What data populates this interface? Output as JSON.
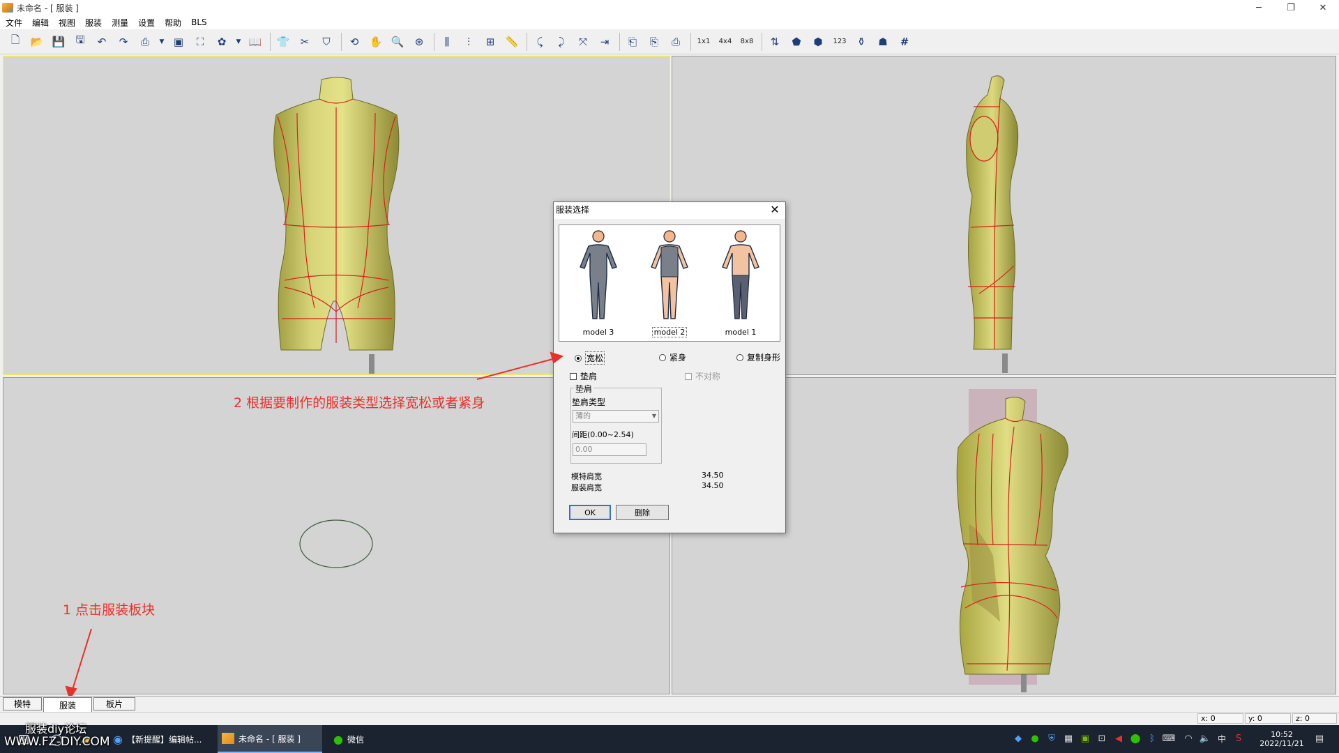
{
  "window": {
    "title": "未命名 - [ 服装 ]",
    "minimize_glyph": "─",
    "restore_glyph": "❐",
    "close_glyph": "✕"
  },
  "menu": [
    "文件",
    "编辑",
    "视图",
    "服装",
    "测量",
    "设置",
    "帮助",
    "BLS"
  ],
  "toolbar": {
    "icons": [
      "new-file-icon",
      "open-file-icon",
      "save-icon",
      "save-as-icon",
      "undo-icon",
      "redo-icon",
      "print-icon",
      "layout-icon",
      "view-image-icon",
      "texture-icon",
      "book-icon",
      "shirt-icon",
      "garment-icon",
      "tshirt-icon",
      "rotate-icon",
      "pan-hand-icon",
      "zoom-icon",
      "orbit-icon",
      "measure-vertical-icon",
      "measure-split-icon",
      "measure-grid-icon",
      "ruler-icon",
      "curve-left-icon",
      "curve-right-icon",
      "scale-icon",
      "align-icon",
      "import-icon",
      "export-icon",
      "print-pattern-icon"
    ],
    "grid_labels": [
      "1x1",
      "4x4",
      "8x8"
    ],
    "end_icons": [
      "lift-icon",
      "pentagon-icon",
      "fill-icon",
      "number-icon",
      "dress-form-icon",
      "body-icon",
      "grid-icon"
    ]
  },
  "tabs": [
    {
      "label": "模特",
      "active": false
    },
    {
      "label": "服装",
      "active": true
    },
    {
      "label": "板片",
      "active": false
    }
  ],
  "status": {
    "x": "x: 0",
    "y": "y: 0",
    "z": "z: 0"
  },
  "dialog": {
    "title": "服装选择",
    "models": [
      {
        "label": "model 3",
        "selected": false
      },
      {
        "label": "model 2",
        "selected": true
      },
      {
        "label": "model 1",
        "selected": false
      }
    ],
    "fit_options": [
      {
        "label": "宽松",
        "checked": true
      },
      {
        "label": "紧身",
        "checked": false
      },
      {
        "label": "复制身形",
        "checked": false
      }
    ],
    "shoulder_pad_label": "垫肩",
    "asymmetric_label": "不对称",
    "pad_group_label": "垫肩",
    "pad_type_label": "垫肩类型",
    "pad_type_value": "薄的",
    "gap_label": "间距(0.00~2.54)",
    "gap_value": "0.00",
    "model_shoulder_label": "模特肩宽",
    "model_shoulder_value": "34.50",
    "garment_shoulder_label": "服装肩宽",
    "garment_shoulder_value": "34.50",
    "ok_label": "OK",
    "delete_label": "删除"
  },
  "annotations": {
    "step1": "1 点击服装板块",
    "step2": "2 根据要制作的服装类型选择宽松或者紧身",
    "color": "#e8312a"
  },
  "watermark": {
    "line1": "服装diy论坛",
    "line2": "WWW.FZ-DIY.COM"
  },
  "taskbar": {
    "items": [
      {
        "label": "【新提醒】编辑帖...",
        "active": false
      },
      {
        "label": "未命名 - [ 服装 ]",
        "active": true
      },
      {
        "label": "微信",
        "active": false
      }
    ],
    "ime": "中",
    "time": "10:52",
    "date": "2022/11/21"
  }
}
